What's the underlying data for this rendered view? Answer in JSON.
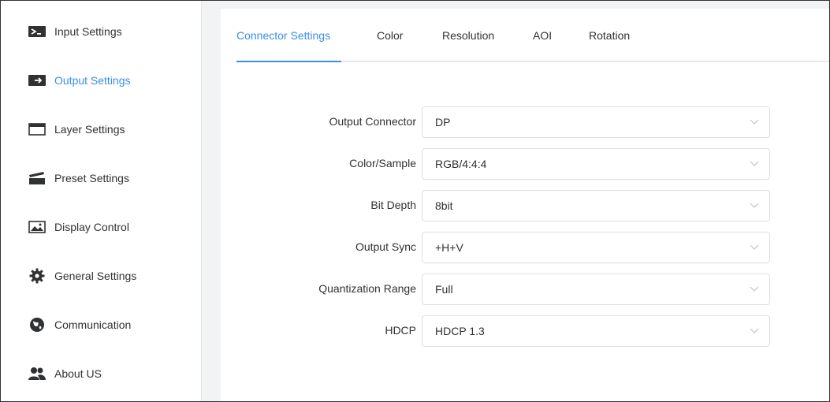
{
  "sidebar": {
    "items": [
      {
        "label": "Input Settings",
        "icon": "input-icon"
      },
      {
        "label": "Output Settings",
        "icon": "output-icon",
        "active": true
      },
      {
        "label": "Layer Settings",
        "icon": "window-icon"
      },
      {
        "label": "Preset Settings",
        "icon": "clapperboard-icon"
      },
      {
        "label": "Display Control",
        "icon": "image-icon"
      },
      {
        "label": "General Settings",
        "icon": "gear-icon"
      },
      {
        "label": "Communication",
        "icon": "globe-icon"
      },
      {
        "label": "About US",
        "icon": "users-icon"
      }
    ]
  },
  "tabs": [
    {
      "label": "Connector Settings",
      "active": true
    },
    {
      "label": "Color"
    },
    {
      "label": "Resolution"
    },
    {
      "label": "AOI"
    },
    {
      "label": "Rotation"
    }
  ],
  "form": {
    "fields": [
      {
        "label": "Output Connector",
        "value": "DP"
      },
      {
        "label": "Color/Sample",
        "value": "RGB/4:4:4"
      },
      {
        "label": "Bit Depth",
        "value": "8bit"
      },
      {
        "label": "Output Sync",
        "value": "+H+V"
      },
      {
        "label": "Quantization Range",
        "value": "Full"
      },
      {
        "label": "HDCP",
        "value": "HDCP 1.3"
      }
    ]
  },
  "colors": {
    "accent": "#3a8ee6",
    "text": "#303133",
    "background": "#f2f3f5"
  }
}
